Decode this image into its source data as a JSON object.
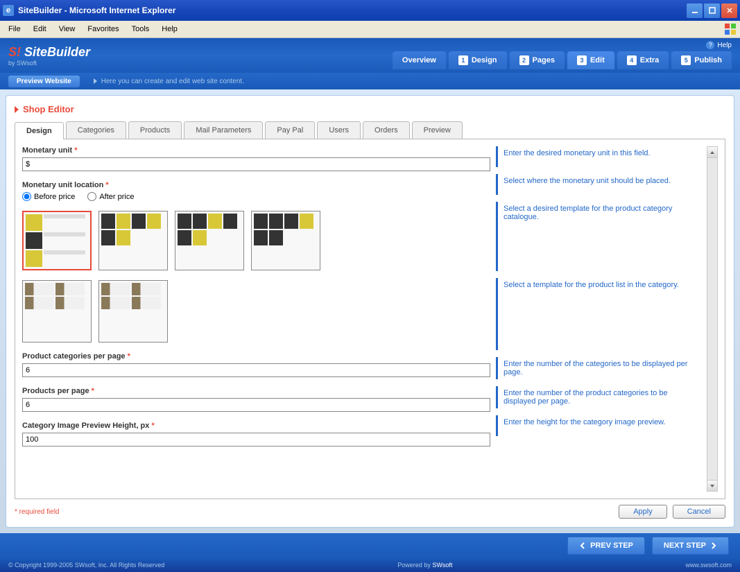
{
  "window": {
    "title": "SiteBuilder - Microsoft Internet Explorer"
  },
  "menubar": [
    "File",
    "Edit",
    "View",
    "Favorites",
    "Tools",
    "Help"
  ],
  "header": {
    "logo_prefix": "S!",
    "logo_main": "SiteBuilder",
    "logo_sub": "by SWsoft",
    "help_label": "Help"
  },
  "nav": {
    "items": [
      {
        "label": "Overview",
        "num": ""
      },
      {
        "label": "Design",
        "num": "1"
      },
      {
        "label": "Pages",
        "num": "2"
      },
      {
        "label": "Edit",
        "num": "3",
        "active": true
      },
      {
        "label": "Extra",
        "num": "4"
      },
      {
        "label": "Publish",
        "num": "5"
      }
    ]
  },
  "subheader": {
    "preview_label": "Preview Website",
    "desc": "Here you can create and edit web site content."
  },
  "breadcrumb": "Shop Editor",
  "tabs": [
    "Design",
    "Categories",
    "Products",
    "Mail Parameters",
    "Pay Pal",
    "Users",
    "Orders",
    "Preview"
  ],
  "active_tab": 0,
  "fields": {
    "monetary_unit": {
      "label": "Monetary unit",
      "value": "$"
    },
    "location": {
      "label": "Monetary unit location",
      "opt1": "Before price",
      "opt2": "After price"
    },
    "categories_per_page": {
      "label": "Product categories per page",
      "value": "6"
    },
    "products_per_page": {
      "label": "Products per page",
      "value": "6"
    },
    "image_height": {
      "label": "Category Image Preview Height, px",
      "value": "100"
    }
  },
  "help": {
    "monetary_unit": "Enter the desired monetary unit in this field.",
    "location": "Select where the monetary unit should be placed.",
    "templates1": "Select a desired template for the product category catalogue.",
    "templates2": "Select a template for the product list in the category.",
    "categories_per_page": "Enter the number of the categories to be displayed per page.",
    "products_per_page": "Enter the number of the product categories to be displayed per page.",
    "image_height": "Enter the height for the category image preview."
  },
  "required_note": "* required field",
  "buttons": {
    "apply": "Apply",
    "cancel": "Cancel",
    "prev": "PREV STEP",
    "next": "NEXT STEP"
  },
  "footer": {
    "copyright": "© Copyright 1999-2005 SWsoft, Inc. All Rights Reserved",
    "powered": "Powered by",
    "powered_by": "SWsoft",
    "link": "www.swsoft.com"
  }
}
